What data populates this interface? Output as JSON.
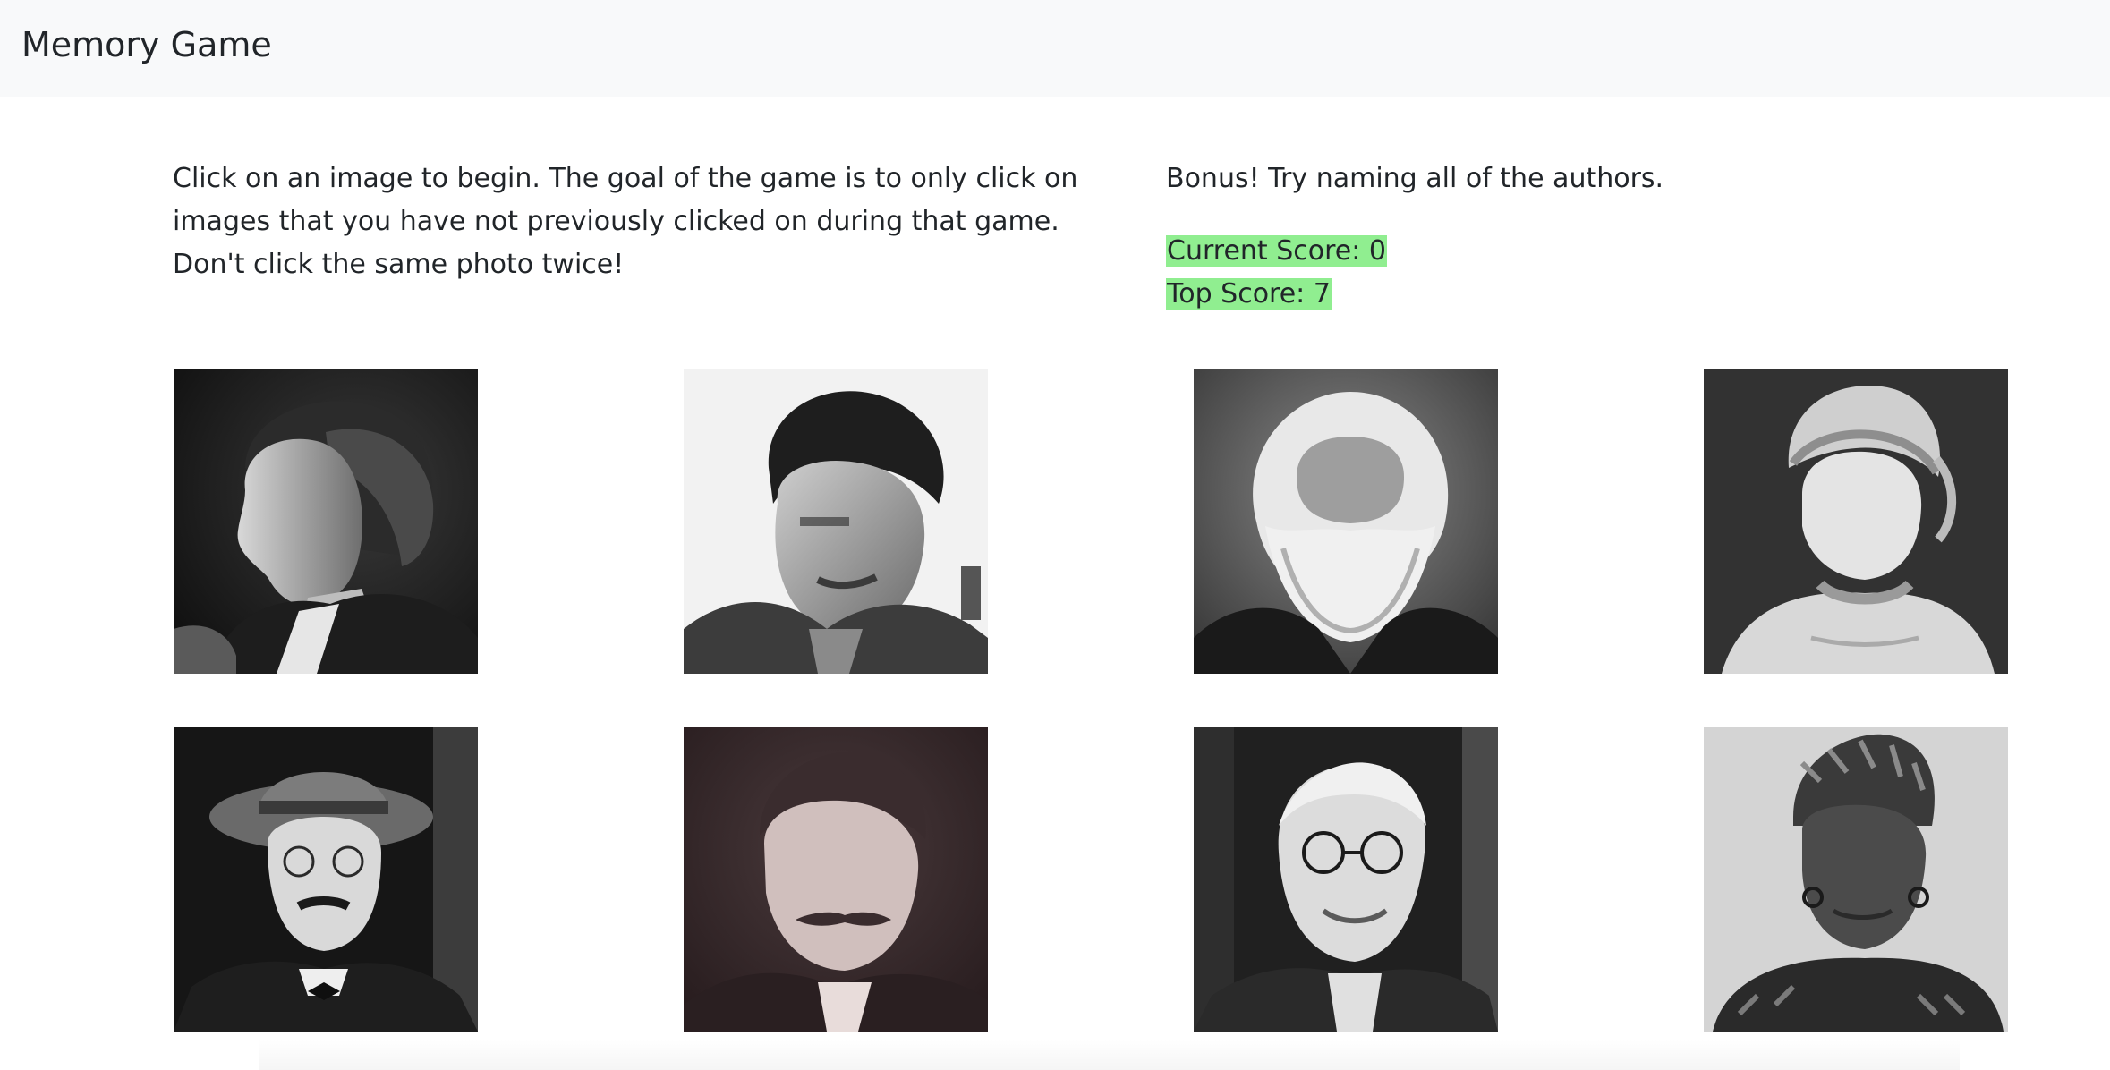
{
  "navbar": {
    "brand": "Memory Game"
  },
  "instructions": "Click on an image to begin. The goal of the game is to only click on images that you have not previously clicked on during that game. Don't click the same photo twice!",
  "bonus": "Bonus! Try naming all of the authors.",
  "score": {
    "current_label": "Current Score:",
    "current_value": "0",
    "top_label": "Top Score:",
    "top_value": "7"
  },
  "colors": {
    "navbar_bg": "#f8f9fa",
    "score_highlight": "#90ee90",
    "text": "#212529"
  },
  "tiles": [
    {
      "icon": "portrait-woman-profile"
    },
    {
      "icon": "portrait-man-dark-hair"
    },
    {
      "icon": "portrait-bearded-man"
    },
    {
      "icon": "portrait-woman-engraving"
    },
    {
      "icon": "portrait-man-hat-glasses"
    },
    {
      "icon": "portrait-man-mustache"
    },
    {
      "icon": "portrait-man-round-glasses"
    },
    {
      "icon": "portrait-woman-headwrap"
    }
  ]
}
